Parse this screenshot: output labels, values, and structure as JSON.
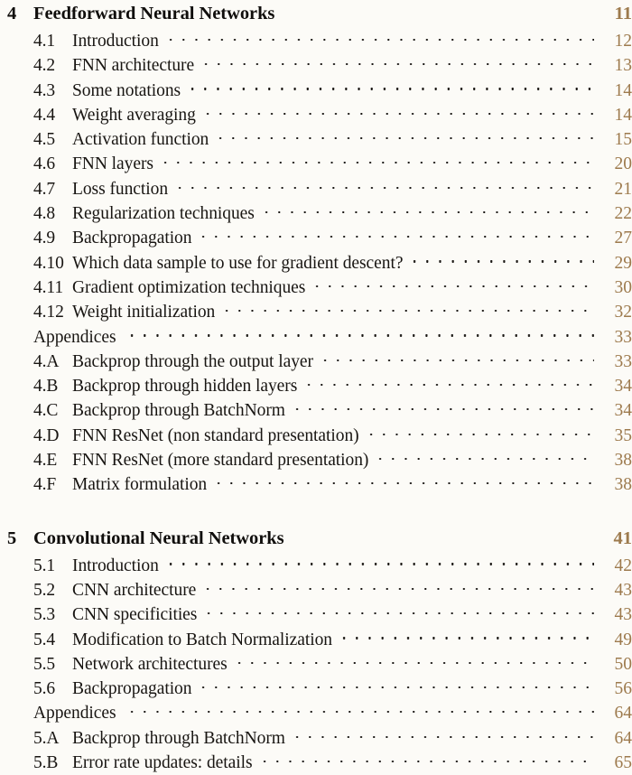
{
  "document": {
    "type": "table-of-contents",
    "page_number_color": "#9d7a4d",
    "text_color": "#181512",
    "background_color": "#fcfbf7"
  },
  "entries": [
    {
      "kind": "chapter",
      "number": "4",
      "title": "Feedforward Neural Networks",
      "page": "11"
    },
    {
      "kind": "section",
      "number": "4.1",
      "title": "Introduction",
      "page": "12"
    },
    {
      "kind": "section",
      "number": "4.2",
      "title": "FNN architecture",
      "page": "13"
    },
    {
      "kind": "section",
      "number": "4.3",
      "title": "Some notations",
      "page": "14"
    },
    {
      "kind": "section",
      "number": "4.4",
      "title": "Weight averaging",
      "page": "14"
    },
    {
      "kind": "section",
      "number": "4.5",
      "title": "Activation function",
      "page": "15"
    },
    {
      "kind": "section",
      "number": "4.6",
      "title": "FNN layers",
      "page": "20"
    },
    {
      "kind": "section",
      "number": "4.7",
      "title": "Loss function",
      "page": "21"
    },
    {
      "kind": "section",
      "number": "4.8",
      "title": "Regularization techniques",
      "page": "22"
    },
    {
      "kind": "section",
      "number": "4.9",
      "title": "Backpropagation",
      "page": "27"
    },
    {
      "kind": "section",
      "number": "4.10",
      "title": "Which data sample to use for gradient descent?",
      "page": "29"
    },
    {
      "kind": "section",
      "number": "4.11",
      "title": "Gradient optimization techniques",
      "page": "30"
    },
    {
      "kind": "section",
      "number": "4.12",
      "title": "Weight initialization",
      "page": "32"
    },
    {
      "kind": "appendix-head",
      "number": "",
      "title": "Appendices",
      "page": "33"
    },
    {
      "kind": "section",
      "number": "4.A",
      "title": "Backprop through the output layer",
      "page": "33"
    },
    {
      "kind": "section",
      "number": "4.B",
      "title": "Backprop through hidden layers",
      "page": "34"
    },
    {
      "kind": "section",
      "number": "4.C",
      "title": "Backprop through BatchNorm",
      "page": "34"
    },
    {
      "kind": "section",
      "number": "4.D",
      "title": "FNN ResNet (non standard presentation)",
      "page": "35"
    },
    {
      "kind": "section",
      "number": "4.E",
      "title": "FNN ResNet (more standard presentation)",
      "page": "38"
    },
    {
      "kind": "section",
      "number": "4.F",
      "title": "Matrix formulation",
      "page": "38"
    },
    {
      "kind": "gap",
      "number": "",
      "title": "",
      "page": ""
    },
    {
      "kind": "chapter",
      "number": "5",
      "title": "Convolutional Neural Networks",
      "page": "41"
    },
    {
      "kind": "section",
      "number": "5.1",
      "title": "Introduction",
      "page": "42"
    },
    {
      "kind": "section",
      "number": "5.2",
      "title": "CNN architecture",
      "page": "43"
    },
    {
      "kind": "section",
      "number": "5.3",
      "title": "CNN specificities",
      "page": "43"
    },
    {
      "kind": "section",
      "number": "5.4",
      "title": "Modification to Batch Normalization",
      "page": "49"
    },
    {
      "kind": "section",
      "number": "5.5",
      "title": "Network architectures",
      "page": "50"
    },
    {
      "kind": "section",
      "number": "5.6",
      "title": "Backpropagation",
      "page": "56"
    },
    {
      "kind": "appendix-head",
      "number": "",
      "title": "Appendices",
      "page": "64"
    },
    {
      "kind": "section",
      "number": "5.A",
      "title": "Backprop through BatchNorm",
      "page": "64"
    },
    {
      "kind": "section",
      "number": "5.B",
      "title": "Error rate updates: details",
      "page": "65"
    }
  ]
}
